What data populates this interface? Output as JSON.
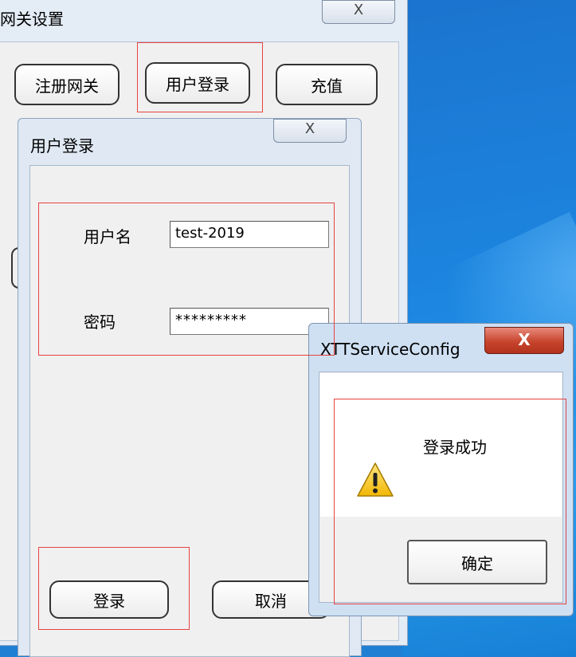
{
  "main_window": {
    "title": "网关设置",
    "close_glyph": "X",
    "buttons": {
      "register_gateway": "注册网关",
      "user_login": "用户登录",
      "recharge": "充值"
    }
  },
  "login_dialog": {
    "title": "用户登录",
    "close_glyph": "X",
    "username_label": "用户名",
    "username_value": "test-2019",
    "password_label": "密码",
    "password_value": "*********",
    "login_button": "登录",
    "cancel_button": "取消"
  },
  "message_box": {
    "title": "XTTServiceConfig",
    "close_glyph": "X",
    "message": "登录成功",
    "ok_button": "确定",
    "icon": "warning-icon"
  },
  "colors": {
    "highlight_box": "#e8423f",
    "desktop": "#1c86e0"
  }
}
